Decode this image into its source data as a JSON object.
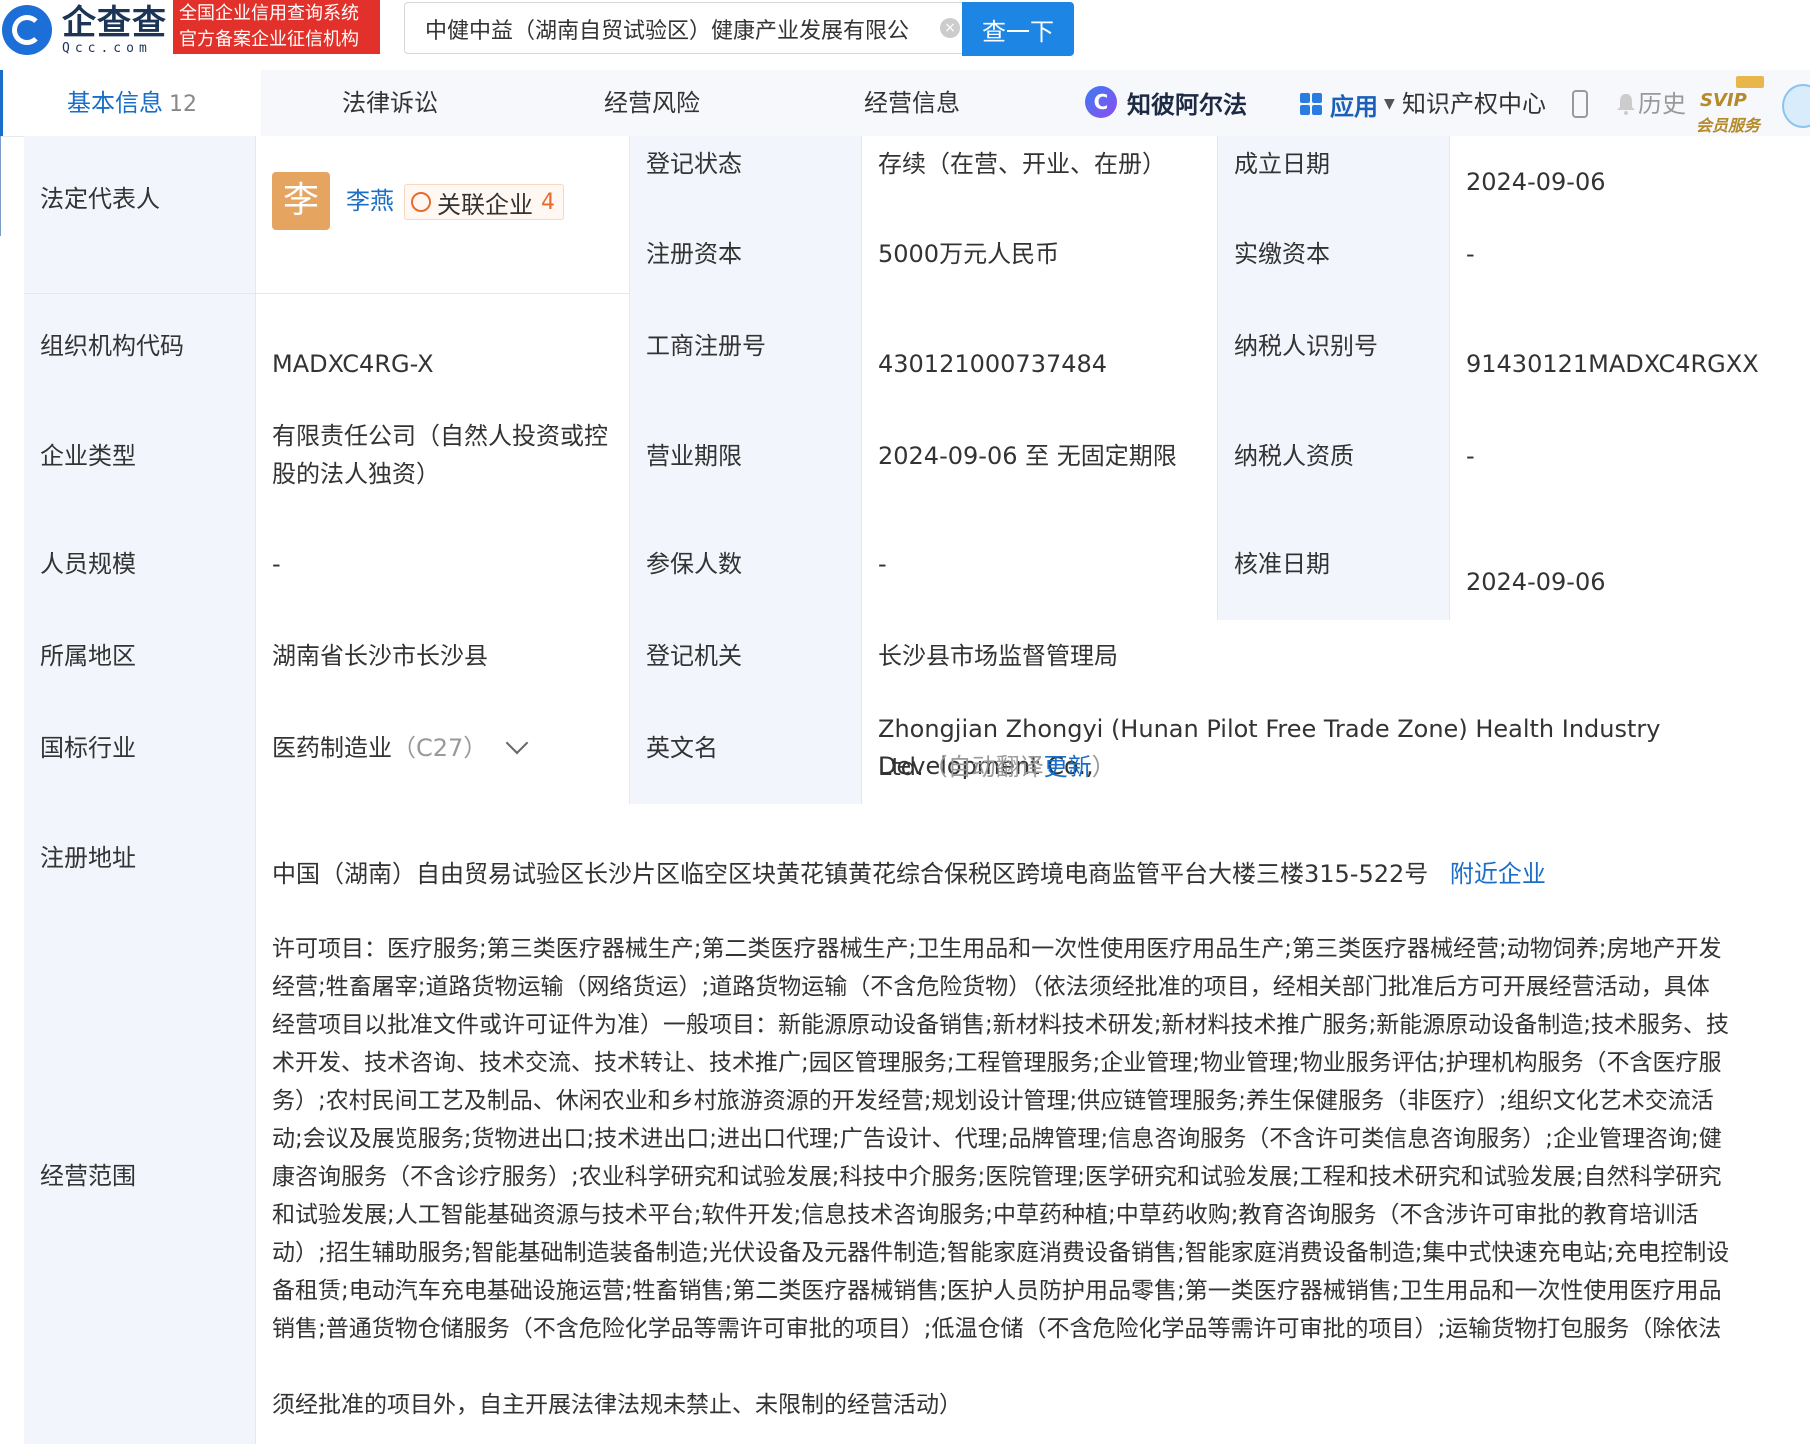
{
  "header": {
    "logo_cn": "企查查",
    "logo_en": "Qcc.com",
    "badge_line1": "全国企业信用查询系统",
    "badge_line2": "官方备案企业征信机构",
    "search_value": "中健中益（湖南自贸试验区）健康产业发展有限公",
    "search_button": "查一下"
  },
  "tabs": [
    {
      "label": "基本信息",
      "count": "12"
    },
    {
      "label": "法律诉讼"
    },
    {
      "label": "经营风险"
    },
    {
      "label": "经营信息"
    }
  ],
  "toolbar": {
    "zbaef_label": "知彼阿尔法",
    "apps_label": "应用",
    "ip_center": "知识产权中心",
    "history": "历史",
    "svip_top": "SVIP",
    "svip_bottom": "会员服务"
  },
  "info": {
    "legal_rep": {
      "label": "法定代表人",
      "avatar_char": "李",
      "name": "李燕",
      "related_label": "关联企业",
      "related_count": "4"
    },
    "reg_status": {
      "label": "登记状态",
      "value": "存续（在营、开业、在册）"
    },
    "founded": {
      "label": "成立日期",
      "value": "2024-09-06"
    },
    "reg_capital": {
      "label": "注册资本",
      "value": "5000万元人民币"
    },
    "paid_capital": {
      "label": "实缴资本",
      "value": "-"
    },
    "org_code": {
      "label": "组织机构代码",
      "value": "MADXC4RG-X"
    },
    "biz_reg_no": {
      "label": "工商注册号",
      "value": "430121000737484"
    },
    "taxpayer_id": {
      "label": "纳税人识别号",
      "value": "91430121MADXC4RGXX"
    },
    "company_type": {
      "label": "企业类型",
      "value_line1": "有限责任公司（自然人投资或控",
      "value_line2": "股的法人独资）"
    },
    "biz_term": {
      "label": "营业期限",
      "value": "2024-09-06 至 无固定期限"
    },
    "taxpayer_qual": {
      "label": "纳税人资质",
      "value": "-"
    },
    "staff_size": {
      "label": "人员规模",
      "value": "-"
    },
    "insured": {
      "label": "参保人数",
      "value": "-"
    },
    "approval_date": {
      "label": "核准日期",
      "value": "2024-09-06"
    },
    "region": {
      "label": "所属地区",
      "value": "湖南省长沙市长沙县"
    },
    "reg_authority": {
      "label": "登记机关",
      "value": "长沙县市场监督管理局"
    },
    "industry": {
      "label": "国标行业",
      "value": "医药制造业",
      "code": "（C27）"
    },
    "english_name": {
      "label": "英文名",
      "value_line1": "Zhongjian Zhongyi (Hunan Pilot Free Trade Zone) Health Industry Development Co.,",
      "value_line2": "Ltd.",
      "auto_translate": "（自动翻译",
      "update_link": "更新",
      "close_paren": "）"
    },
    "reg_address": {
      "label": "注册地址",
      "value": "中国（湖南）自由贸易试验区长沙片区临空区块黄花镇黄花综合保税区跨境电商监管平台大楼三楼315-522号",
      "nearby_link": "附近企业"
    },
    "biz_scope": {
      "label": "经营范围",
      "lines": [
        "许可项目：医疗服务;第三类医疗器械生产;第二类医疗器械生产;卫生用品和一次性使用医疗用品生产;第三类医疗器械经营;动物饲养;房地产开发",
        "经营;牲畜屠宰;道路货物运输（网络货运）;道路货物运输（不含危险货物）（依法须经批准的项目，经相关部门批准后方可开展经营活动，具体",
        "经营项目以批准文件或许可证件为准）一般项目：新能源原动设备销售;新材料技术研发;新材料技术推广服务;新能源原动设备制造;技术服务、技",
        "术开发、技术咨询、技术交流、技术转让、技术推广;园区管理服务;工程管理服务;企业管理;物业管理;物业服务评估;护理机构服务（不含医疗服",
        "务）;农村民间工艺及制品、休闲农业和乡村旅游资源的开发经营;规划设计管理;供应链管理服务;养生保健服务（非医疗）;组织文化艺术交流活",
        "动;会议及展览服务;货物进出口;技术进出口;进出口代理;广告设计、代理;品牌管理;信息咨询服务（不含许可类信息咨询服务）;企业管理咨询;健",
        "康咨询服务（不含诊疗服务）;农业科学研究和试验发展;科技中介服务;医院管理;医学研究和试验发展;工程和技术研究和试验发展;自然科学研究",
        "和试验发展;人工智能基础资源与技术平台;软件开发;信息技术咨询服务;中草药种植;中草药收购;教育咨询服务（不含涉许可审批的教育培训活",
        "动）;招生辅助服务;智能基础制造装备制造;光伏设备及元器件制造;智能家庭消费设备销售;智能家庭消费设备制造;集中式快速充电站;充电控制设",
        "备租赁;电动汽车充电基础设施运营;牲畜销售;第二类医疗器械销售;医护人员防护用品零售;第一类医疗器械销售;卫生用品和一次性使用医疗用品",
        "销售;普通货物仓储服务（不含危险化学品等需许可审批的项目）;低温仓储（不含危险化学品等需许可审批的项目）;运输货物打包服务（除依法",
        "须经批准的项目外，自主开展法律法规未禁止、未限制的经营活动）"
      ]
    }
  },
  "colors": {
    "accent": "#1a6ec8",
    "label_bg": "#f2f6fc",
    "brand_red": "#e1312a",
    "search_btn": "#1d86e5",
    "related": "#e76b2f"
  }
}
